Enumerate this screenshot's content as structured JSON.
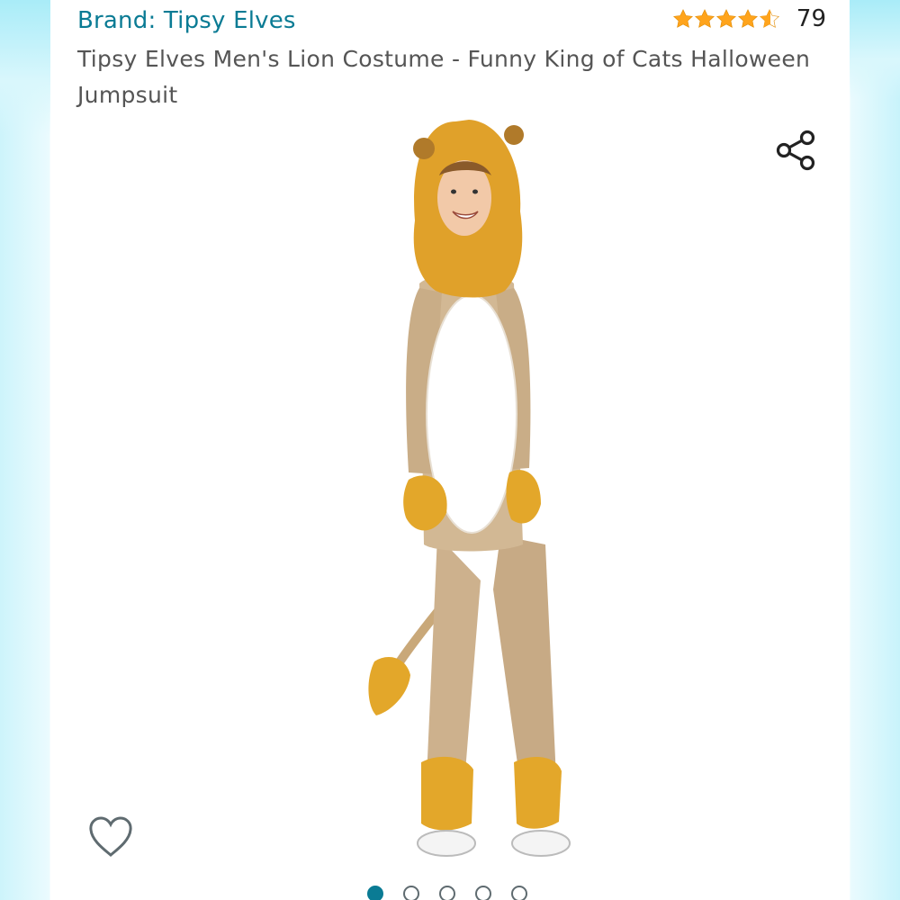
{
  "product": {
    "brand_link": "Brand: Tipsy Elves",
    "title": "Tipsy Elves Men's Lion Costume - Funny King of Cats Halloween Jumpsuit",
    "rating_stars": 4.5,
    "rating_count": "79"
  },
  "icons": {
    "share": "share-icon",
    "wishlist": "heart-outline-icon",
    "star": "star-icon"
  },
  "carousel": {
    "total_images": 5,
    "active_index": 0
  },
  "colors": {
    "brand_link": "#0a7b94",
    "star": "#ffa41c",
    "active_dot": "#0a7b94"
  }
}
